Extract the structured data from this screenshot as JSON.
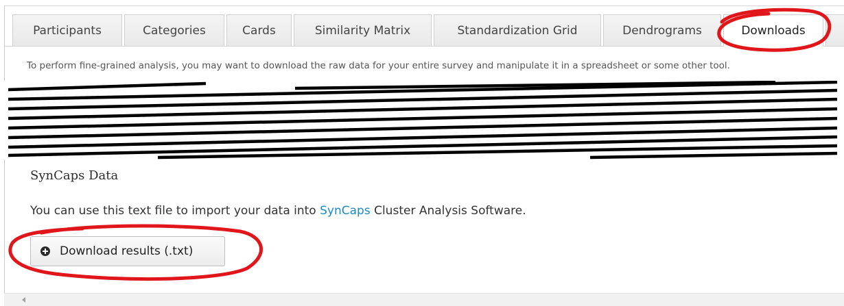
{
  "tabs": [
    {
      "label": "Participants"
    },
    {
      "label": "Categories"
    },
    {
      "label": "Cards"
    },
    {
      "label": "Similarity Matrix"
    },
    {
      "label": "Standardization Grid"
    },
    {
      "label": "Dendrograms"
    },
    {
      "label": "Downloads"
    },
    {
      "label": ""
    }
  ],
  "active_tab": "Downloads",
  "intro_text": "To perform fine-grained analysis, you may want to download the raw data for your entire survey and manipulate it in a spreadsheet or some other tool.",
  "section": {
    "title": "SynCaps Data",
    "desc_before": "You can use this text file to import your data into ",
    "desc_link": "SynCaps",
    "desc_after": " Cluster Analysis Software."
  },
  "download_button": {
    "icon": "plus-circle-icon",
    "label": "Download results (.txt)"
  },
  "colors": {
    "link": "#1a8ac8",
    "highlight": "#e0161b"
  }
}
